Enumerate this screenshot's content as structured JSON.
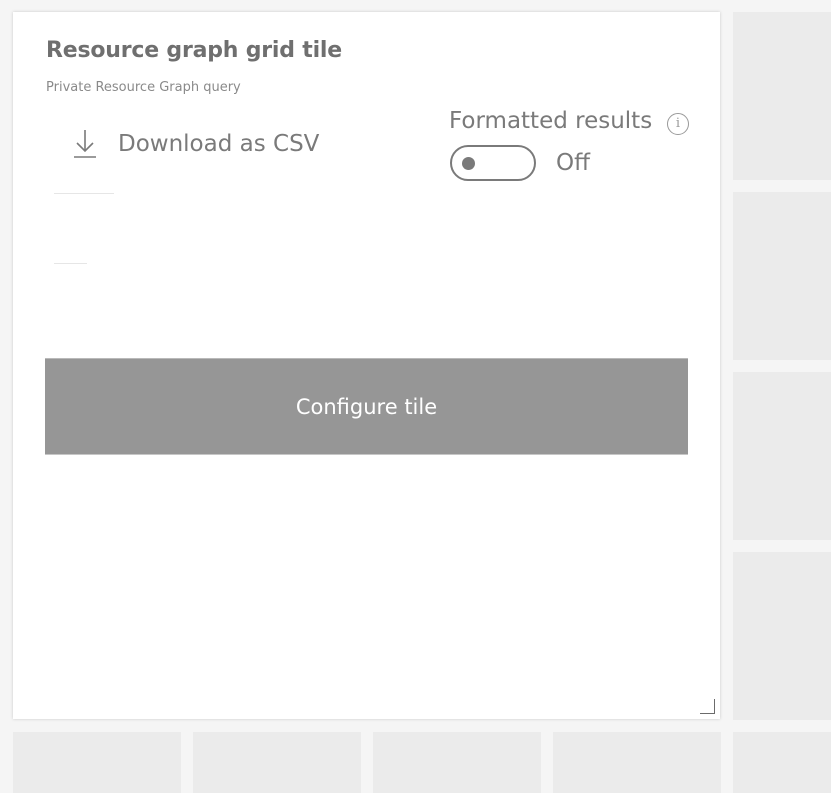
{
  "tile": {
    "title": "Resource graph grid tile",
    "subtitle": "Private Resource Graph query",
    "download_label": "Download as CSV",
    "formatted_results_label": "Formatted results",
    "info_icon_glyph": "i",
    "toggle_state_label": "Off",
    "toggle_on": false,
    "configure_button_label": "Configure tile"
  },
  "icons": {
    "download": "download-icon",
    "info": "info-icon",
    "resize": "resize-handle-icon"
  },
  "colors": {
    "tile_background": "#ffffff",
    "grid_placeholder": "#ebebeb",
    "configure_button": "#969696",
    "text_muted": "#7a7a7a"
  }
}
